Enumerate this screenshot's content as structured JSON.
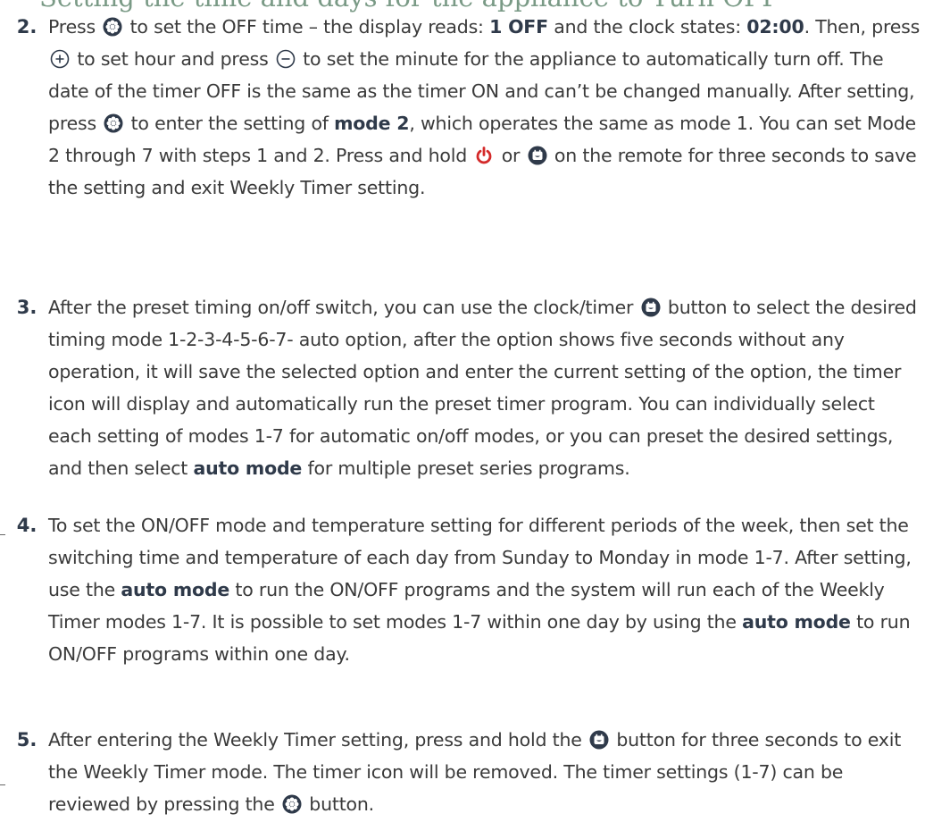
{
  "heading": "Setting the time and days for the appliance to Turn OFF",
  "items": [
    {
      "number": "2.",
      "p1": "Press ",
      "p2": " to set the OFF time – the display reads: ",
      "b1": "1 OFF",
      "p3": " and the clock states: ",
      "b2": "02:00",
      "p4": ". Then, press ",
      "p5": " to set hour and press ",
      "p6": " to set the minute for the appliance to automatically turn off. The date of the timer OFF is the same as the timer ON and can’t be changed manually. After setting, press ",
      "p7": " to enter the setting of ",
      "b3": "mode 2",
      "p8": ", which operates the same as mode 1. You can set Mode 2 through 7 with steps 1 and 2. Press and hold ",
      "p9": " or ",
      "p10": " on the remote for three seconds to save the setting and exit Weekly Timer setting."
    },
    {
      "number": "3.",
      "p1": "After the preset timing on/off switch, you can use the clock/timer ",
      "p2": " button to select the desired timing mode 1-2-3-4-5-6-7- auto option, after the option shows five seconds without any operation, it will save the selected option and enter the current setting of the option, the timer icon will display and automatically run the preset timer program. You can individually select each setting of modes 1-7 for automatic on/off modes, or you can preset the desired settings, and then select ",
      "b1": "auto mode",
      "p3": " for multiple preset series programs."
    },
    {
      "number": "4.",
      "p1": "To set the ON/OFF mode and temperature setting for different periods of the week, then set the switching time and temperature of each day from Sunday to Monday in mode 1-7. After setting, use the ",
      "b1": "auto mode",
      "p2": " to run the ON/OFF programs and the system will run each of the Weekly Timer modes 1-7. It is possible to set modes 1-7 within one day by using the ",
      "b2": "auto mode",
      "p3": " to run ON/OFF programs within one day."
    },
    {
      "number": "5.",
      "p1": "After entering the Weekly Timer setting, press and hold the ",
      "p2": " button for three seconds to exit the Weekly Timer mode. The timer icon will be removed. The timer settings (1-7) can be reviewed by pressing the ",
      "p3": " button."
    }
  ],
  "icons": {
    "settings": "gear-button-icon",
    "plus": "plus-button-icon",
    "minus": "minus-button-icon",
    "power": "power-icon",
    "timer": "clock-timer-button-icon"
  },
  "colors": {
    "heading": "#7a9a86",
    "text": "#3a3a3a",
    "bold": "#2f3a4a",
    "power": "#d42a2a"
  }
}
